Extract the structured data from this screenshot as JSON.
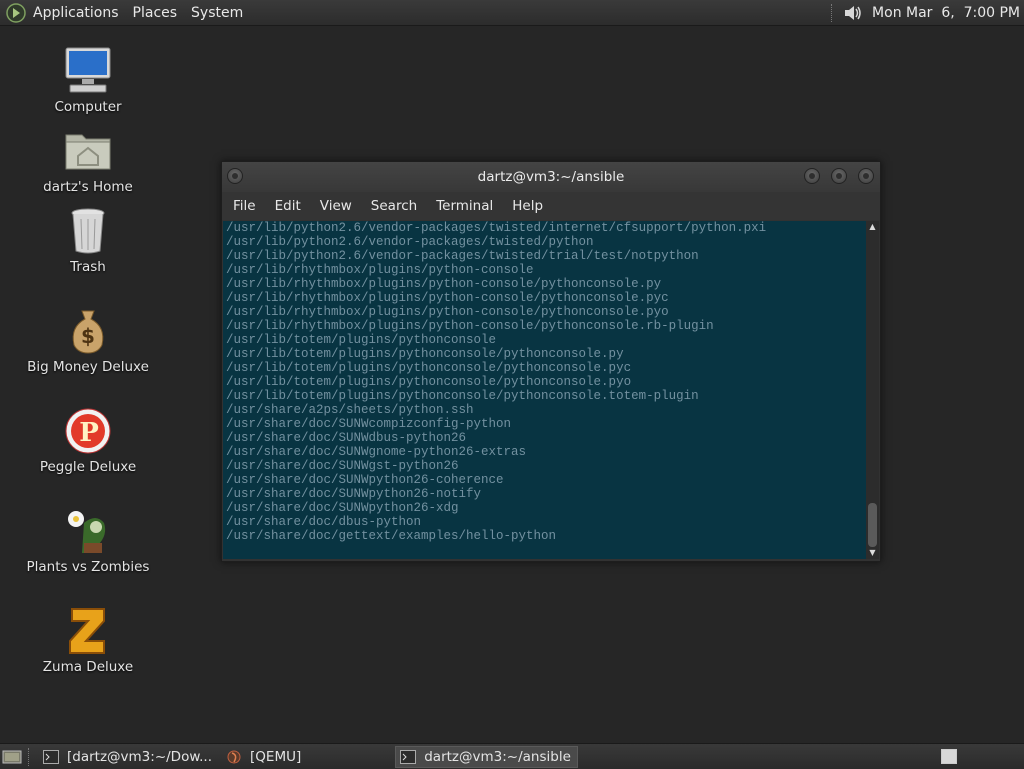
{
  "top_panel": {
    "menus": [
      "Applications",
      "Places",
      "System"
    ],
    "clock": "Mon Mar  6,  7:00 PM"
  },
  "desktop": {
    "icons": [
      {
        "label": "Computer",
        "icon": "computer-icon"
      },
      {
        "label": "dartz's Home",
        "icon": "home-folder-icon"
      },
      {
        "label": "Trash",
        "icon": "trash-icon"
      },
      {
        "label": "Big Money Deluxe",
        "icon": "money-bag-icon"
      },
      {
        "label": "Peggle Deluxe",
        "icon": "peggle-icon"
      },
      {
        "label": "Plants vs Zombies",
        "icon": "plants-vs-zombies-icon"
      },
      {
        "label": "Zuma Deluxe",
        "icon": "zuma-icon"
      }
    ]
  },
  "terminal": {
    "title": "dartz@vm3:~/ansible",
    "menus": [
      "File",
      "Edit",
      "View",
      "Search",
      "Terminal",
      "Help"
    ],
    "lines": [
      "/usr/lib/python2.6/vendor-packages/twisted/internet/cfsupport/python.pxi",
      "/usr/lib/python2.6/vendor-packages/twisted/python",
      "/usr/lib/python2.6/vendor-packages/twisted/trial/test/notpython",
      "/usr/lib/rhythmbox/plugins/python-console",
      "/usr/lib/rhythmbox/plugins/python-console/pythonconsole.py",
      "/usr/lib/rhythmbox/plugins/python-console/pythonconsole.pyc",
      "/usr/lib/rhythmbox/plugins/python-console/pythonconsole.pyo",
      "/usr/lib/rhythmbox/plugins/python-console/pythonconsole.rb-plugin",
      "/usr/lib/totem/plugins/pythonconsole",
      "/usr/lib/totem/plugins/pythonconsole/pythonconsole.py",
      "/usr/lib/totem/plugins/pythonconsole/pythonconsole.pyc",
      "/usr/lib/totem/plugins/pythonconsole/pythonconsole.pyo",
      "/usr/lib/totem/plugins/pythonconsole/pythonconsole.totem-plugin",
      "/usr/share/a2ps/sheets/python.ssh",
      "/usr/share/doc/SUNWcompizconfig-python",
      "/usr/share/doc/SUNWdbus-python26",
      "/usr/share/doc/SUNWgnome-python26-extras",
      "/usr/share/doc/SUNWgst-python26",
      "/usr/share/doc/SUNWpython26-coherence",
      "/usr/share/doc/SUNWpython26-notify",
      "/usr/share/doc/SUNWpython26-xdg",
      "/usr/share/doc/dbus-python",
      "/usr/share/doc/gettext/examples/hello-python"
    ],
    "colors": {
      "background": "#083442",
      "text": "#7391a0"
    }
  },
  "taskbar": {
    "tasks": [
      {
        "label": "[dartz@vm3:~/Dow...",
        "icon": "terminal-icon",
        "active": false
      },
      {
        "label": "[QEMU]",
        "icon": "qemu-icon",
        "active": false
      },
      {
        "label": "dartz@vm3:~/ansible",
        "icon": "terminal-icon",
        "active": true
      }
    ]
  }
}
